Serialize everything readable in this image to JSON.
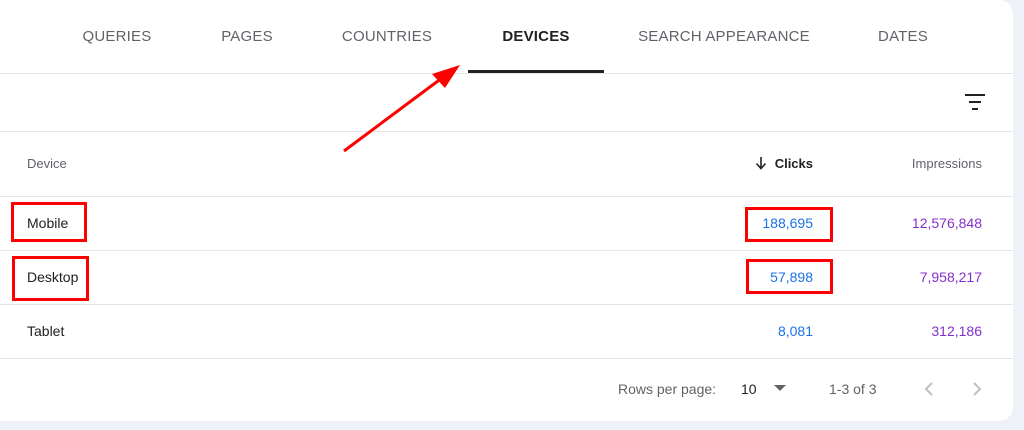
{
  "tabs": [
    {
      "label": "QUERIES"
    },
    {
      "label": "PAGES"
    },
    {
      "label": "COUNTRIES"
    },
    {
      "label": "DEVICES",
      "active": true
    },
    {
      "label": "SEARCH APPEARANCE"
    },
    {
      "label": "DATES"
    }
  ],
  "table": {
    "columns": {
      "device": "Device",
      "clicks": "Clicks",
      "impressions": "Impressions"
    },
    "sort": {
      "column": "clicks",
      "direction": "descending"
    },
    "rows": [
      {
        "device": "Mobile",
        "clicks": "188,695",
        "impressions": "12,576,848"
      },
      {
        "device": "Desktop",
        "clicks": "57,898",
        "impressions": "7,958,217"
      },
      {
        "device": "Tablet",
        "clicks": "8,081",
        "impressions": "312,186"
      }
    ]
  },
  "footer": {
    "rows_per_page_label": "Rows per page:",
    "rows_per_page_value": "10",
    "range": "1-3 of 3"
  },
  "icons": {
    "filter": "filter-icon",
    "sort": "arrow-down-icon",
    "dropdown": "caret-down-icon",
    "prev": "chevron-left-icon",
    "next": "chevron-right-icon"
  },
  "colors": {
    "clicks": "#1a73e8",
    "impressions": "#8430ce",
    "annotation": "#ff0000",
    "active_tab": "#202124"
  }
}
